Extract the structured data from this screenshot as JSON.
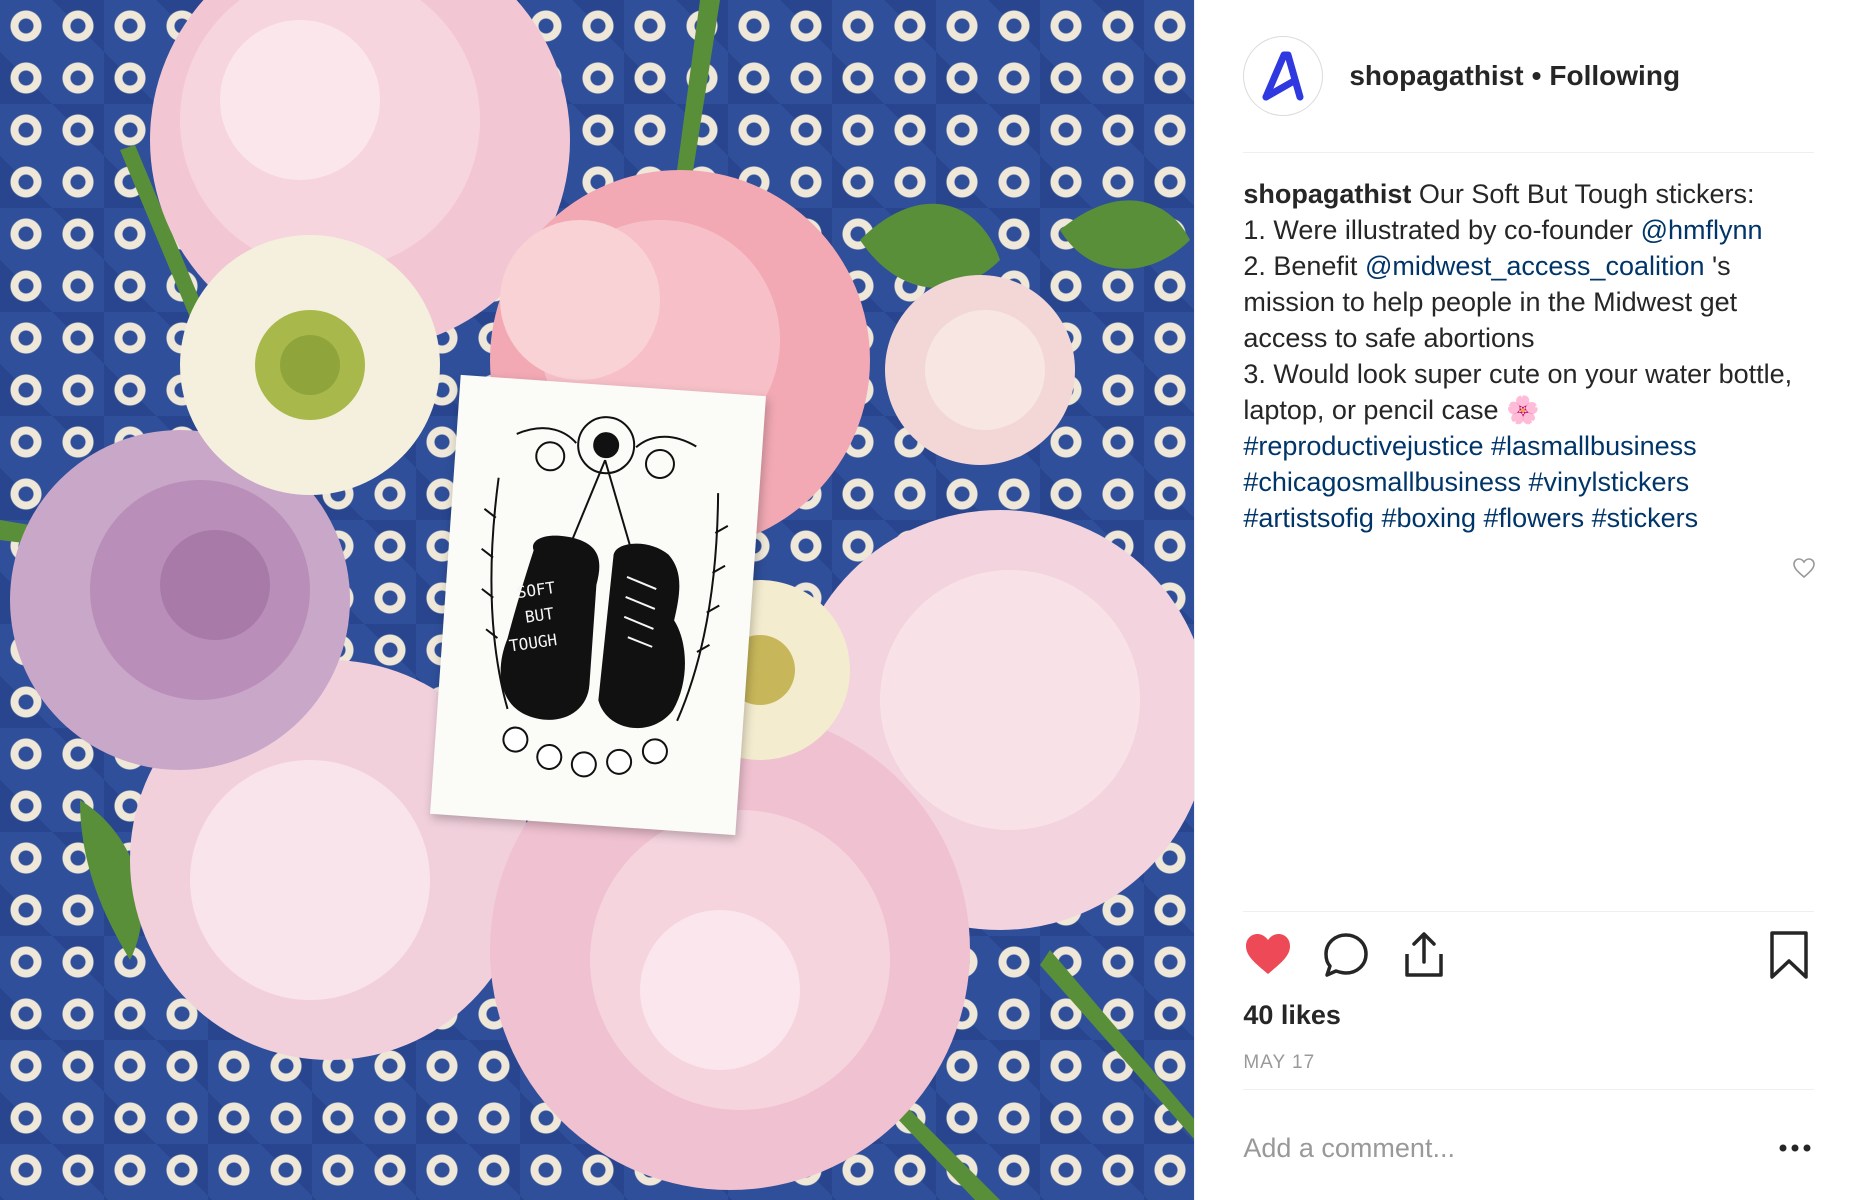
{
  "post": {
    "username": "shopagathist",
    "separator": "•",
    "follow_status": "Following",
    "avatar_letter": "A",
    "caption": {
      "username": "shopagathist",
      "line1": " Our Soft But Tough stickers:",
      "line2_text": "1. Were illustrated by co-founder ",
      "line2_mention": "@hmflynn",
      "line3_text": "2. Benefit ",
      "line3_mention": "@midwest_access_coalition",
      "line3_after": " 's mission to help people in the Midwest get access to safe abortions",
      "line4_text": "3. Would look super cute on your water bottle, laptop, or pencil case",
      "line4_emoji": "🌸",
      "hashtags": [
        "#reproductivejustice",
        "#lasmallbusiness",
        "#chicagosmallbusiness",
        "#vinylstickers",
        "#artistsofig",
        "#boxing",
        "#flowers",
        "#stickers"
      ]
    },
    "likes": "40 likes",
    "date": "MAY 17",
    "comment_placeholder": "Add a comment...",
    "sticker_text": [
      "SOFT",
      "BUT",
      "TOUGH"
    ]
  },
  "icons": {
    "like": "heart-filled-icon",
    "comment": "comment-bubble-icon",
    "share": "share-icon",
    "save": "bookmark-icon",
    "more": "more-options-icon",
    "caption_like": "heart-outline-icon"
  },
  "colors": {
    "brand_avatar": "#2f39e0",
    "like_red": "#ed4956",
    "link_blue": "#003569",
    "muted_gray": "#999999",
    "pattern_blue": "#2f4f9a"
  }
}
